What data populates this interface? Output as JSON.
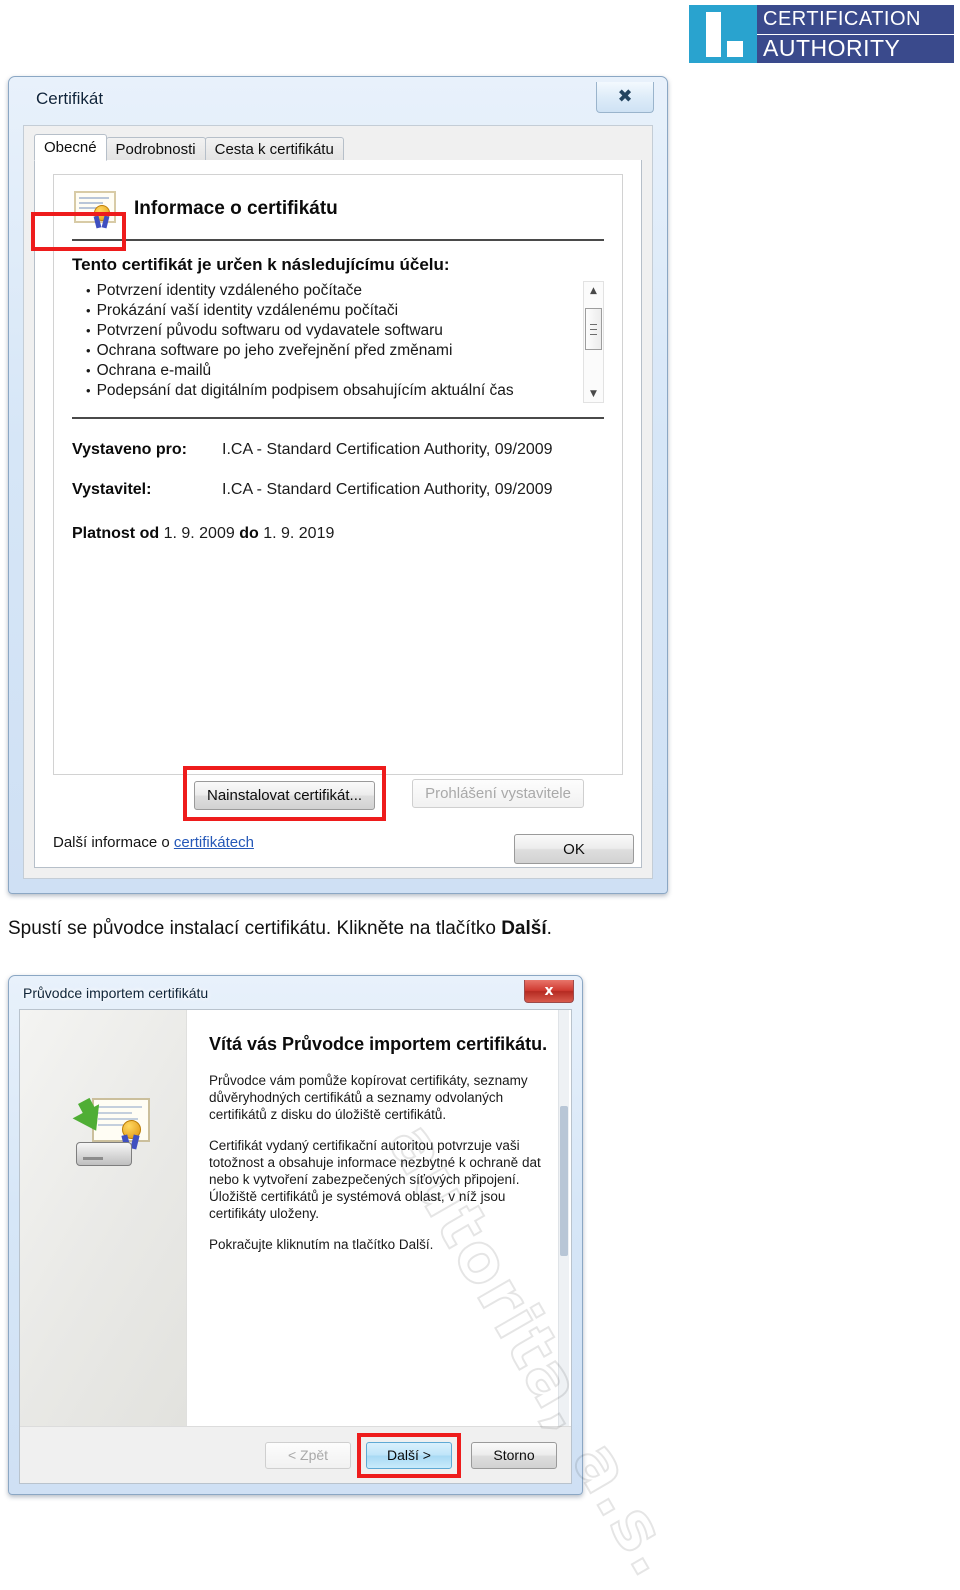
{
  "logo": {
    "mark_alt": "i-mark",
    "line1": "CERTIFICATION",
    "line2": "AUTHORITY",
    "accent_cyan": "#29a3cf",
    "accent_navy": "#3a4a8c"
  },
  "watermark": {
    "text": "autorita, a.s."
  },
  "highlight_color": "#ee1c1c",
  "certificate_dialog": {
    "title": "Certifikát",
    "close_label": "✖",
    "tabs": [
      {
        "label": "Obecné",
        "active": true
      },
      {
        "label": "Podrobnosti",
        "active": false
      },
      {
        "label": "Cesta k certifikátu",
        "active": false
      }
    ],
    "panel_title": "Informace o certifikátu",
    "purpose_heading": "Tento certifikát je určen k následujícímu účelu:",
    "purposes": [
      "Potvrzení identity vzdáleného počítače",
      "Prokázání vaší identity vzdálenému počítači",
      "Potvrzení původu softwaru od vydavatele softwaru",
      "Ochrana software po jeho zveřejnění před změnami",
      "Ochrana e-mailů",
      "Podepsání dat digitálním podpisem obsahujícím aktuální čas"
    ],
    "issued_to_label": "Vystaveno pro:",
    "issued_to_value": "I.CA - Standard Certification Authority, 09/2009",
    "issuer_label": "Vystavitel:",
    "issuer_value": "I.CA - Standard Certification Authority, 09/2009",
    "validity_label": "Platnost od",
    "validity_from": "1. 9. 2009",
    "validity_to_label": "do",
    "validity_to": "1. 9. 2019",
    "install_button": "Nainstalovat certifikát...",
    "issuer_statement_button": "Prohlášení vystavitele",
    "more_info_prefix": "Další informace o",
    "more_info_link": "certifikátech",
    "ok_button": "OK"
  },
  "caption": {
    "text_before": "Spustí se původce instalací certifikátu. Klikněte na tlačítko ",
    "text_bold": "Další",
    "text_after": "."
  },
  "wizard_dialog": {
    "title": "Průvodce importem certifikátu",
    "close_label": "x",
    "heading": "Vítá vás Průvodce importem certifikátu.",
    "paragraphs": [
      "Průvodce vám pomůže kopírovat certifikáty, seznamy důvěryhodných certifikátů a seznamy odvolaných certifikátů z disku do úložiště certifikátů.",
      "Certifikát vydaný certifikační autoritou potvrzuje vaši totožnost a obsahuje informace nezbytné k ochraně dat nebo k vytvoření zabezpečených síťových připojení. Úložiště certifikátů je systémová oblast, v níž jsou certifikáty uloženy.",
      "Pokračujte kliknutím na tlačítko Další."
    ],
    "back_button": "< Zpět",
    "next_button": "Další >",
    "cancel_button": "Storno"
  }
}
